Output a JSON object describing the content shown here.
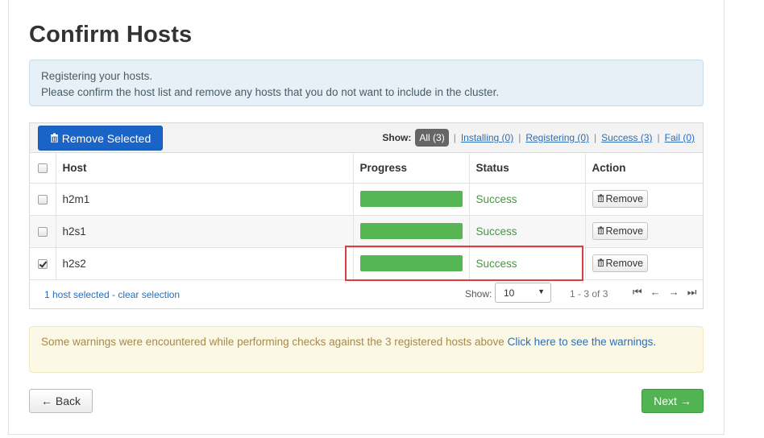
{
  "page": {
    "title": "Confirm Hosts"
  },
  "info": {
    "line1": "Registering your hosts.",
    "line2": "Please confirm the host list and remove any hosts that you do not want to include in the cluster."
  },
  "toolbar": {
    "remove_selected_label": "Remove Selected",
    "show_label": "Show:",
    "filters": {
      "all": "All (3)",
      "installing": "Installing (0)",
      "registering": "Registering (0)",
      "success": "Success (3)",
      "fail": "Fail (0)"
    }
  },
  "table": {
    "headers": {
      "host": "Host",
      "progress": "Progress",
      "status": "Status",
      "action": "Action"
    },
    "rows": [
      {
        "host": "h2m1",
        "progress": 100,
        "status": "Success",
        "action": "Remove",
        "checked": false
      },
      {
        "host": "h2s1",
        "progress": 100,
        "status": "Success",
        "action": "Remove",
        "checked": false
      },
      {
        "host": "h2s2",
        "progress": 100,
        "status": "Success",
        "action": "Remove",
        "checked": true
      }
    ]
  },
  "pager": {
    "selection_text": "1 host selected - clear selection",
    "show_label": "Show:",
    "page_size": "10",
    "range": "1 - 3 of 3"
  },
  "warning": {
    "text": "Some warnings were encountered while performing checks against the 3 registered hosts above ",
    "link": "Click here to see the warnings."
  },
  "footer": {
    "back_label": "← Back",
    "next_label": "Next →"
  },
  "colors": {
    "primary": "#1b64c7",
    "success": "#56b653",
    "highlight": "#e23b3b"
  }
}
